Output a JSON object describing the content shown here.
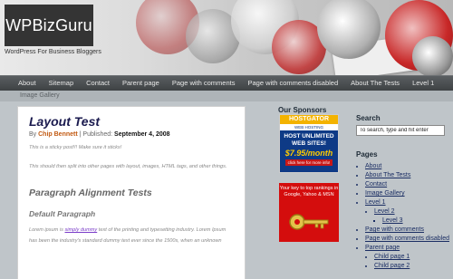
{
  "header": {
    "logo": "WPBizGuru",
    "tagline": "WordPress For Business Bloggers"
  },
  "nav": {
    "items": [
      "About",
      "Sitemap",
      "Contact",
      "Parent page",
      "Page with comments",
      "Page with comments disabled",
      "About The Tests",
      "Level 1"
    ]
  },
  "breadcrumb": "Image Gallery",
  "post": {
    "title": "Layout Test",
    "meta_by": "By",
    "author": "Chip Bennett",
    "published_label": "| Published:",
    "date": "September 4, 2008",
    "sticky_text": "This is a sticky post!!! Make sure it sticks!",
    "split_text": "This should then split into other pages with layout, images, HTML tags, and other things.",
    "h_align": "Paragraph Alignment Tests",
    "h_default": "Default Paragraph",
    "lorem_1a": "Lorem ipsum is ",
    "lorem_link": "simply dummy",
    "lorem_1b": " text of the printing and typesetting industry. Lorem Ipsum",
    "lorem_2": "has been the industry's standard dummy text ever since the 1500s, when an unknown"
  },
  "sponsors": {
    "title": "Our Sponsors",
    "hostgator": {
      "brand": "HOSTGATOR",
      "sub": "WEB HOSTING",
      "main_1": "HOST UNLIMITED",
      "main_2": "WEB SITES!",
      "price": "$7.95/month",
      "button": "click here for more info!"
    },
    "key_ad": {
      "text": "Your key to top rankings in Google, Yahoo & MSN"
    }
  },
  "sidebar": {
    "search_title": "Search",
    "search_value": "To search, type and hit enter",
    "pages_title": "Pages",
    "pages": {
      "about": "About",
      "about_tests": "About The Tests",
      "contact": "Contact",
      "image_gallery": "Image Gallery",
      "level1": "Level 1",
      "level2": "Level 2",
      "level3": "Level 3",
      "page_comments": "Page with comments",
      "page_comments_disabled": "Page with comments disabled",
      "parent_page": "Parent page",
      "child1": "Child page 1",
      "child2": "Child page 2"
    }
  }
}
